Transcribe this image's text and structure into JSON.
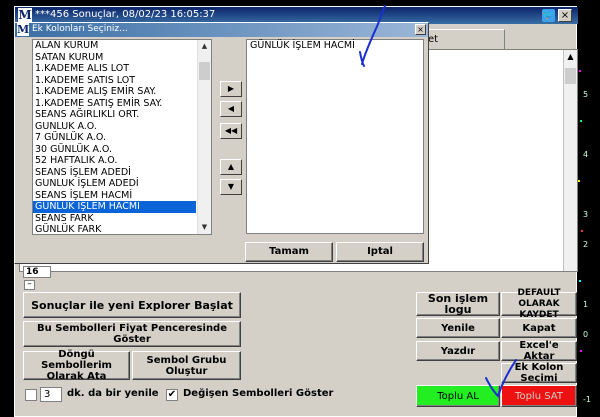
{
  "app": {
    "logo_letter": "M",
    "main_title": "***456 Sonuçlar, 08/02/23 16:05:37",
    "close_glyph": "×",
    "tab_label": "et",
    "row_count": "16",
    "minimize_glyph": "–"
  },
  "dialog": {
    "title": "Ek Kolonları Seçiniz...",
    "close_glyph": "×",
    "available_columns": [
      "ALAN KURUM",
      "SATAN KURUM",
      "1.KADEME ALIS LOT",
      "1.KADEME SATIS LOT",
      "1.KADEME ALIŞ EMİR SAY.",
      "1.KADEME SATIŞ EMİR SAY.",
      "SEANS AĞIRLIKLI ORT.",
      "GUNLUK A.O.",
      "7 GÜNLÜK A.O.",
      "30 GÜNLÜK A.O.",
      "52 HAFTALIK A.O.",
      "SEANS İŞLEM ADEDİ",
      "GUNLUK İŞLEM ADEDİ",
      "SEANS İŞLEM HACMİ",
      "GÜNLÜK İŞLEM HACMİ",
      "SEANS FARK",
      "GÜNLÜK FARK"
    ],
    "selected_index": 14,
    "selected_columns": [
      "GÜNLÜK İŞLEM HACMİ"
    ],
    "move_buttons": [
      "▶",
      "◀",
      "◀◀",
      "▲",
      "▼"
    ],
    "ok_label": "Tamam",
    "cancel_label": "Iptal"
  },
  "actions": {
    "start_explorer": "Sonuçlar ile yeni Explorer Başlat",
    "show_in_price_window": "Bu Sembolleri Fiyat Penceresinde Göster",
    "assign_loop_symbols": "Döngü Sembollerim Olarak Ata",
    "create_symbol_group": "Sembol Grubu Oluştur",
    "last_trade_logo": "Son işlem logu",
    "save_default": "DEFAULT OLARAK KAYDET",
    "refresh": "Yenile",
    "close": "Kapat",
    "print": "Yazdır",
    "export_excel": "Excel'e Aktar",
    "add_column": "Ek Kolon Seçimi",
    "bulk_buy": "Toplu AL",
    "bulk_sell": "Toplu SAT"
  },
  "refresh": {
    "interval_value": "3",
    "interval_label": "dk. da bir yenile",
    "show_changed_label": "Değişen Sembolleri Göster",
    "show_changed_checked": "✔"
  },
  "background_chart": {
    "tick_labels": [
      "5",
      "4",
      "3",
      "2",
      "1",
      "0",
      "-1"
    ]
  },
  "colors": {
    "title_blue": "#0a246a",
    "selection_blue": "#0a64d8",
    "buy_green": "#22ee22",
    "sell_red": "#ee1111",
    "annotation_blue": "#1a2fd0"
  }
}
